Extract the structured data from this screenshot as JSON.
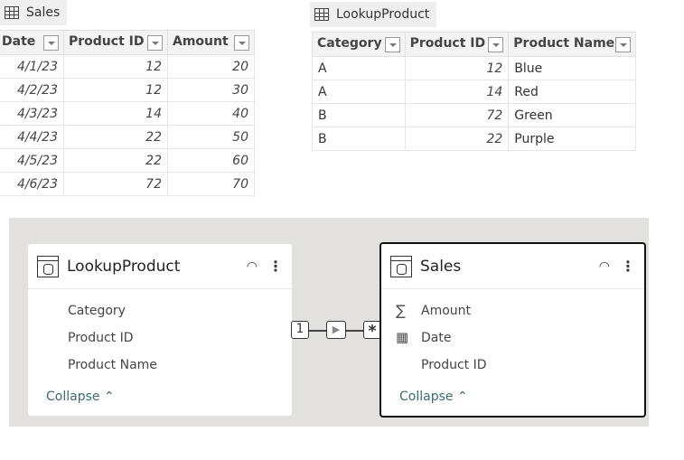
{
  "sales_tab": {
    "label": "Sales",
    "icon": "table-icon"
  },
  "lookup_tab": {
    "label": "LookupProduct",
    "icon": "table-icon"
  },
  "sales_table": {
    "headers": [
      "Date",
      "Product ID",
      "Amount"
    ],
    "rows": [
      [
        "4/1/23",
        "12",
        "20"
      ],
      [
        "4/2/23",
        "12",
        "30"
      ],
      [
        "4/3/23",
        "14",
        "40"
      ],
      [
        "4/4/23",
        "22",
        "50"
      ],
      [
        "4/5/23",
        "22",
        "60"
      ],
      [
        "4/6/23",
        "72",
        "70"
      ]
    ]
  },
  "lookup_table": {
    "headers": [
      "Category",
      "Product ID",
      "Product Name"
    ],
    "rows": [
      [
        "A",
        "12",
        "Blue"
      ],
      [
        "A",
        "14",
        "Red"
      ],
      [
        "B",
        "72",
        "Green"
      ],
      [
        "B",
        "22",
        "Purple"
      ]
    ]
  },
  "diagram": {
    "lookup_card": {
      "title": "LookupProduct",
      "fields": [
        "Category",
        "Product ID",
        "Product Name"
      ],
      "collapse": "Collapse ^"
    },
    "sales_card": {
      "title": "Sales",
      "fields": [
        "Amount",
        "Date",
        "Product ID"
      ],
      "field_icons": [
        "sigma-icon",
        "calendar-icon",
        ""
      ],
      "collapse": "Collapse ^"
    },
    "relationship": {
      "one_side": "1",
      "many_side": "*",
      "direction": "single"
    },
    "collapse_color": "#3a6b73"
  }
}
